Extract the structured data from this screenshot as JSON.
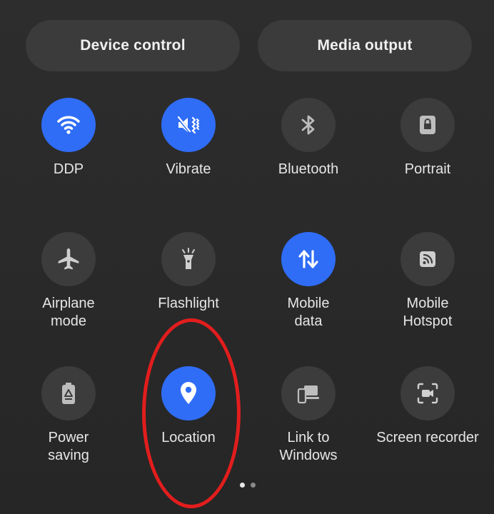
{
  "header": {
    "device_control_label": "Device control",
    "media_output_label": "Media output"
  },
  "tiles": [
    {
      "label": "DDP",
      "icon": "wifi-icon",
      "active": true
    },
    {
      "label": "Vibrate",
      "icon": "vibrate-icon",
      "active": true
    },
    {
      "label": "Bluetooth",
      "icon": "bluetooth-icon",
      "active": false
    },
    {
      "label": "Portrait",
      "icon": "rotation-lock-icon",
      "active": false
    },
    {
      "label": "Airplane\nmode",
      "icon": "airplane-icon",
      "active": false
    },
    {
      "label": "Flashlight",
      "icon": "flashlight-icon",
      "active": false
    },
    {
      "label": "Mobile\ndata",
      "icon": "mobile-data-icon",
      "active": true
    },
    {
      "label": "Mobile\nHotspot",
      "icon": "hotspot-icon",
      "active": false
    },
    {
      "label": "Power\nsaving",
      "icon": "battery-saver-icon",
      "active": false
    },
    {
      "label": "Location",
      "icon": "location-pin-icon",
      "active": true
    },
    {
      "label": "Link to\nWindows",
      "icon": "link-to-windows-icon",
      "active": false
    },
    {
      "label": "Screen recorder",
      "icon": "screen-recorder-icon",
      "active": false
    }
  ],
  "pager": {
    "pages": 2,
    "current": 1
  },
  "colors": {
    "active": "#2f6df6",
    "inactive": "#3c3c3c",
    "background": "#2a2a2a",
    "highlight": "#e21d1d"
  }
}
